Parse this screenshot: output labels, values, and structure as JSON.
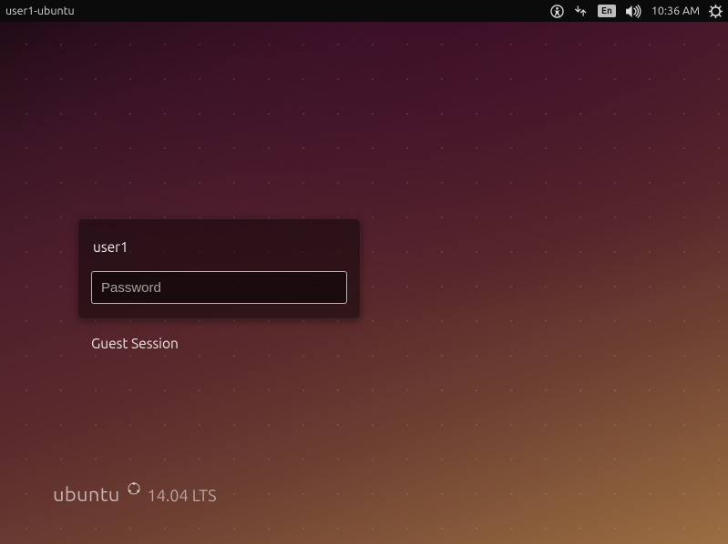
{
  "panel": {
    "hostname": "user1-ubuntu",
    "language": "En",
    "clock": "10:36 AM"
  },
  "login": {
    "selected_user": "user1",
    "password_placeholder": "Password",
    "password_value": "",
    "guest_label": "Guest Session"
  },
  "branding": {
    "name": "ubuntu",
    "version": "14.04 LTS"
  }
}
